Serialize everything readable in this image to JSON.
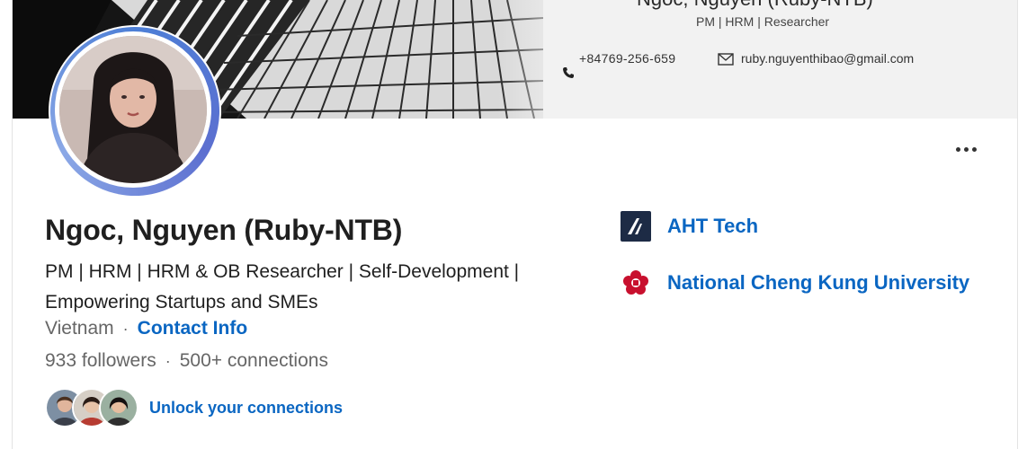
{
  "banner": {
    "name": "Ngoc, Nguyen (Ruby-NTB)",
    "role": "PM | HRM | Researcher",
    "phone": "+84769-256-659",
    "email": "ruby.nguyenthibao@gmail.com"
  },
  "profile": {
    "name": "Ngoc, Nguyen (Ruby-NTB)",
    "headline": "PM | HRM | HRM & OB Researcher | Self-Development | Empowering Startups and SMEs",
    "location": "Vietnam",
    "separator": "·",
    "contact_info_label": "Contact Info",
    "followers": "933 followers",
    "connections": "500+ connections",
    "unlock_label": "Unlock your connections"
  },
  "orgs": [
    {
      "label": "AHT Tech",
      "icon": "aht-tech-logo",
      "color": "#1d2b45"
    },
    {
      "label": "National Cheng Kung University",
      "icon": "ncku-logo",
      "color": "#c8102e"
    }
  ],
  "colors": {
    "link": "#0a66c2",
    "text": "#1f1f1f",
    "muted": "#666666",
    "avatar_ring": "#4d7fd6"
  },
  "icons": {
    "more": "more-horizontal-icon",
    "phone": "phone-icon",
    "mail": "mail-icon"
  }
}
